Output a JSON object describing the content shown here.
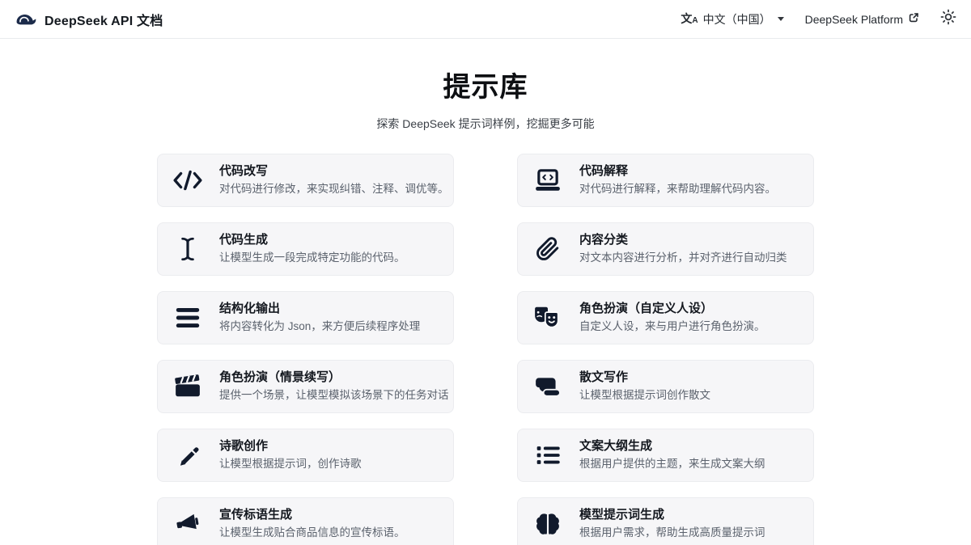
{
  "header": {
    "brand": "DeepSeek API 文档",
    "language": "中文（中国）",
    "language_icon": "translate-icon",
    "platform_link": "DeepSeek Platform",
    "platform_link_icon": "external-link-icon",
    "theme_icon": "sun-icon",
    "logo_icon": "deepseek-whale-icon"
  },
  "hero": {
    "title": "提示库",
    "subtitle": "探索 DeepSeek 提示词样例，挖掘更多可能"
  },
  "cards": {
    "items": [
      {
        "icon": "code-icon",
        "title": "代码改写",
        "desc": "对代码进行修改，来实现纠错、注释、调优等。"
      },
      {
        "icon": "laptop-code-icon",
        "title": "代码解释",
        "desc": "对代码进行解释，来帮助理解代码内容。"
      },
      {
        "icon": "i-cursor-icon",
        "title": "代码生成",
        "desc": "让模型生成一段完成特定功能的代码。"
      },
      {
        "icon": "paperclip-icon",
        "title": "内容分类",
        "desc": "对文本内容进行分析，并对齐进行自动归类"
      },
      {
        "icon": "bars-icon",
        "title": "结构化输出",
        "desc": "将内容转化为 Json，来方便后续程序处理"
      },
      {
        "icon": "theater-masks-icon",
        "title": "角色扮演（自定义人设）",
        "desc": "自定义人设，来与用户进行角色扮演。"
      },
      {
        "icon": "clapperboard-icon",
        "title": "角色扮演（情景续写）",
        "desc": "提供一个场景，让模型模拟该场景下的任务对话"
      },
      {
        "icon": "scroll-icon",
        "title": "散文写作",
        "desc": "让模型根据提示词创作散文"
      },
      {
        "icon": "pencil-icon",
        "title": "诗歌创作",
        "desc": "让模型根据提示词，创作诗歌"
      },
      {
        "icon": "list-icon",
        "title": "文案大纲生成",
        "desc": "根据用户提供的主题，来生成文案大纲"
      },
      {
        "icon": "megaphone-icon",
        "title": "宣传标语生成",
        "desc": "让模型生成贴合商品信息的宣传标语。"
      },
      {
        "icon": "brain-icon",
        "title": "模型提示词生成",
        "desc": "根据用户需求，帮助生成高质量提示词"
      }
    ]
  },
  "colors": {
    "icon_dark": "#111a2c",
    "logo_navy": "#1c2b4a",
    "card_bg": "#f6f6f8",
    "card_border": "#ebecef",
    "desc_gray": "#5b626d",
    "header_border": "#e9ebee"
  }
}
